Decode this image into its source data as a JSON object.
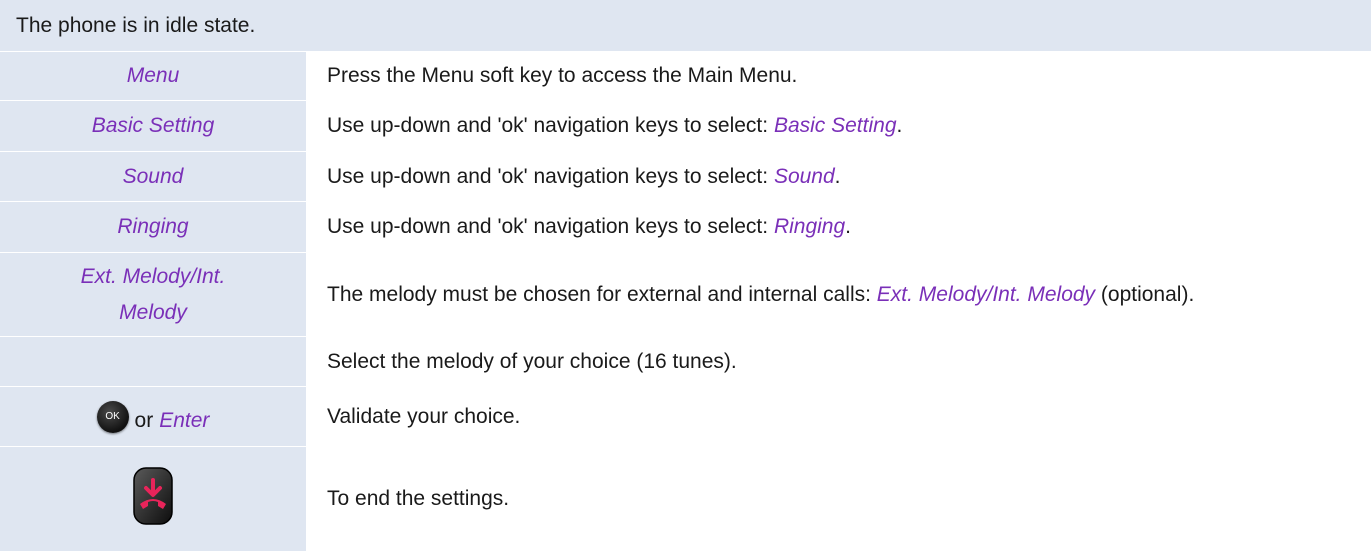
{
  "header": {
    "text": "The phone is in idle state."
  },
  "rows": [
    {
      "left": "Menu",
      "right": "Press the Menu soft key to access the Main Menu."
    },
    {
      "left": "Basic Setting",
      "right_prefix": "Use up-down and 'ok' navigation keys to select: ",
      "right_em": "Basic Setting",
      "right_suffix": "."
    },
    {
      "left": "Sound",
      "right_prefix": "Use up-down and 'ok' navigation keys to select: ",
      "right_em": "Sound",
      "right_suffix": "."
    },
    {
      "left": "Ringing",
      "right_prefix": "Use up-down and 'ok' navigation keys to select: ",
      "right_em": "Ringing",
      "right_suffix": "."
    },
    {
      "left": "Ext. Melody/Int. Melody",
      "right_prefix": "The melody must be chosen for external and internal calls: ",
      "right_em": "Ext. Melody/Int. Melody",
      "right_suffix": " (optional)."
    },
    {
      "left": "",
      "right": "Select the melody of your choice (16 tunes)."
    },
    {
      "left_icon_label": "OK",
      "left_or": "or",
      "left_em": "Enter",
      "right": "Validate your choice."
    },
    {
      "left_icon": "end-call-key-icon",
      "right": "To end the settings."
    }
  ],
  "colors": {
    "accent": "#7a2fb8",
    "label_bg": "#dfe6f1",
    "end_call_red": "#e8245a"
  }
}
